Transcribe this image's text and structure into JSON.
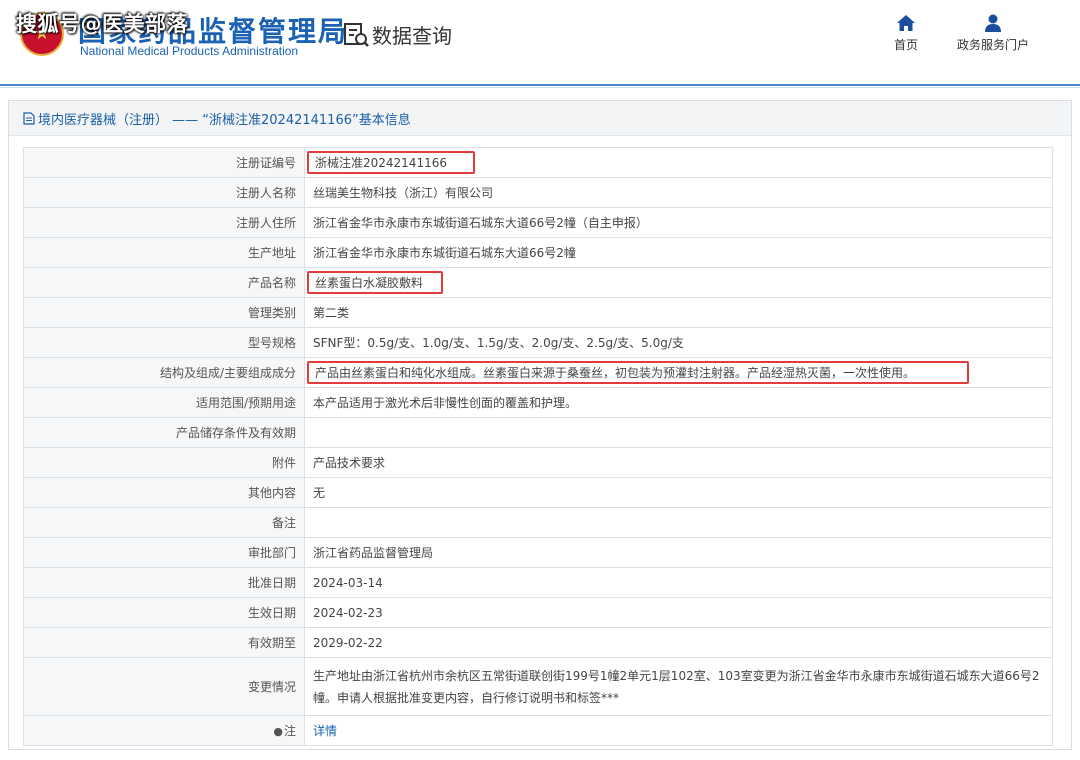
{
  "header": {
    "watermark": "搜狐号@医美部落",
    "agency_cn": "国家药品监督管理局",
    "agency_en": "National Medical Products Administration",
    "data_query": "数据查询",
    "nav": [
      {
        "label": "首页",
        "icon": "home-icon"
      },
      {
        "label": "政务服务门户",
        "icon": "user-icon"
      }
    ]
  },
  "panel": {
    "title": "境内医疗器械（注册） —— “浙械注准20242141166”基本信息",
    "rows": [
      {
        "label": "注册证编号",
        "value": "浙械注准20242141166",
        "highlighted": true
      },
      {
        "label": "注册人名称",
        "value": "丝瑞美生物科技（浙江）有限公司"
      },
      {
        "label": "注册人住所",
        "value": "浙江省金华市永康市东城街道石城东大道66号2幢（自主申报）"
      },
      {
        "label": "生产地址",
        "value": "浙江省金华市永康市东城街道石城东大道66号2幢"
      },
      {
        "label": "产品名称",
        "value": "丝素蛋白水凝胶敷料",
        "highlighted": true
      },
      {
        "label": "管理类别",
        "value": "第二类"
      },
      {
        "label": "型号规格",
        "value": "SFNF型：0.5g/支、1.0g/支、1.5g/支、2.0g/支、2.5g/支、5.0g/支"
      },
      {
        "label": "结构及组成/主要组成成分",
        "value": "产品由丝素蛋白和纯化水组成。丝素蛋白来源于桑蚕丝，初包装为预灌封注射器。产品经湿热灭菌，一次性使用。",
        "highlighted": true
      },
      {
        "label": "适用范围/预期用途",
        "value": "本产品适用于激光术后非慢性创面的覆盖和护理。"
      },
      {
        "label": "产品储存条件及有效期",
        "value": ""
      },
      {
        "label": "附件",
        "value": "产品技术要求"
      },
      {
        "label": "其他内容",
        "value": "无"
      },
      {
        "label": "备注",
        "value": ""
      },
      {
        "label": "审批部门",
        "value": "浙江省药品监督管理局"
      },
      {
        "label": "批准日期",
        "value": "2024-03-14"
      },
      {
        "label": "生效日期",
        "value": "2024-02-23"
      },
      {
        "label": "有效期至",
        "value": "2029-02-22"
      },
      {
        "label": "变更情况",
        "value": "生产地址由浙江省杭州市余杭区五常街道联创街199号1幢2单元1层102室、103室变更为浙江省金华市永康市东城街道石城东大道66号2幢。申请人根据批准变更内容，自行修订说明书和标签***"
      },
      {
        "label": "注",
        "value": "详情",
        "link": true
      }
    ]
  },
  "colors": {
    "brand_blue": "#1b62b4",
    "highlight_red": "#e23d3d",
    "label_bg": "#f6f7f8"
  }
}
